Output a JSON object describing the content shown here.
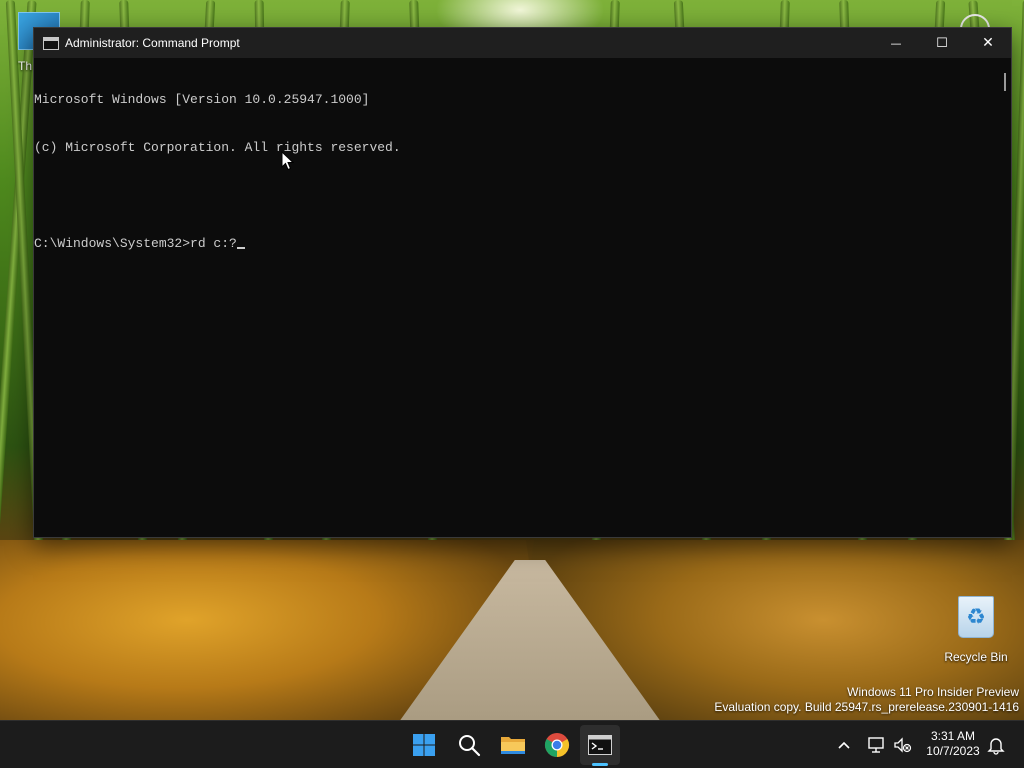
{
  "desktop": {
    "top_left_label": "Th",
    "recycle_bin_label": "Recycle Bin",
    "watermark_line1": "Windows 11 Pro Insider Preview",
    "watermark_line2": "Evaluation copy. Build 25947.rs_prerelease.230901-1416"
  },
  "window": {
    "title": "Administrator: Command Prompt",
    "minimize_glyph": "—",
    "maximize_glyph": "☐",
    "close_glyph": "✕"
  },
  "console": {
    "lines": [
      "Microsoft Windows [Version 10.0.25947.1000]",
      "(c) Microsoft Corporation. All rights reserved.",
      "",
      "C:\\Windows\\System32>rd c:?"
    ]
  },
  "taskbar": {
    "icons": [
      "windows-start-icon",
      "search-icon",
      "file-explorer-icon",
      "chrome-icon",
      "command-prompt-icon"
    ],
    "time": "3:31 AM",
    "date": "10/7/2023"
  },
  "colors": {
    "console_bg": "#0c0c0c",
    "console_fg": "#cccccc",
    "titlebar_bg": "#1f1f1f",
    "taskbar_bg": "#1c1c1c",
    "accent": "#4cc2ff"
  }
}
